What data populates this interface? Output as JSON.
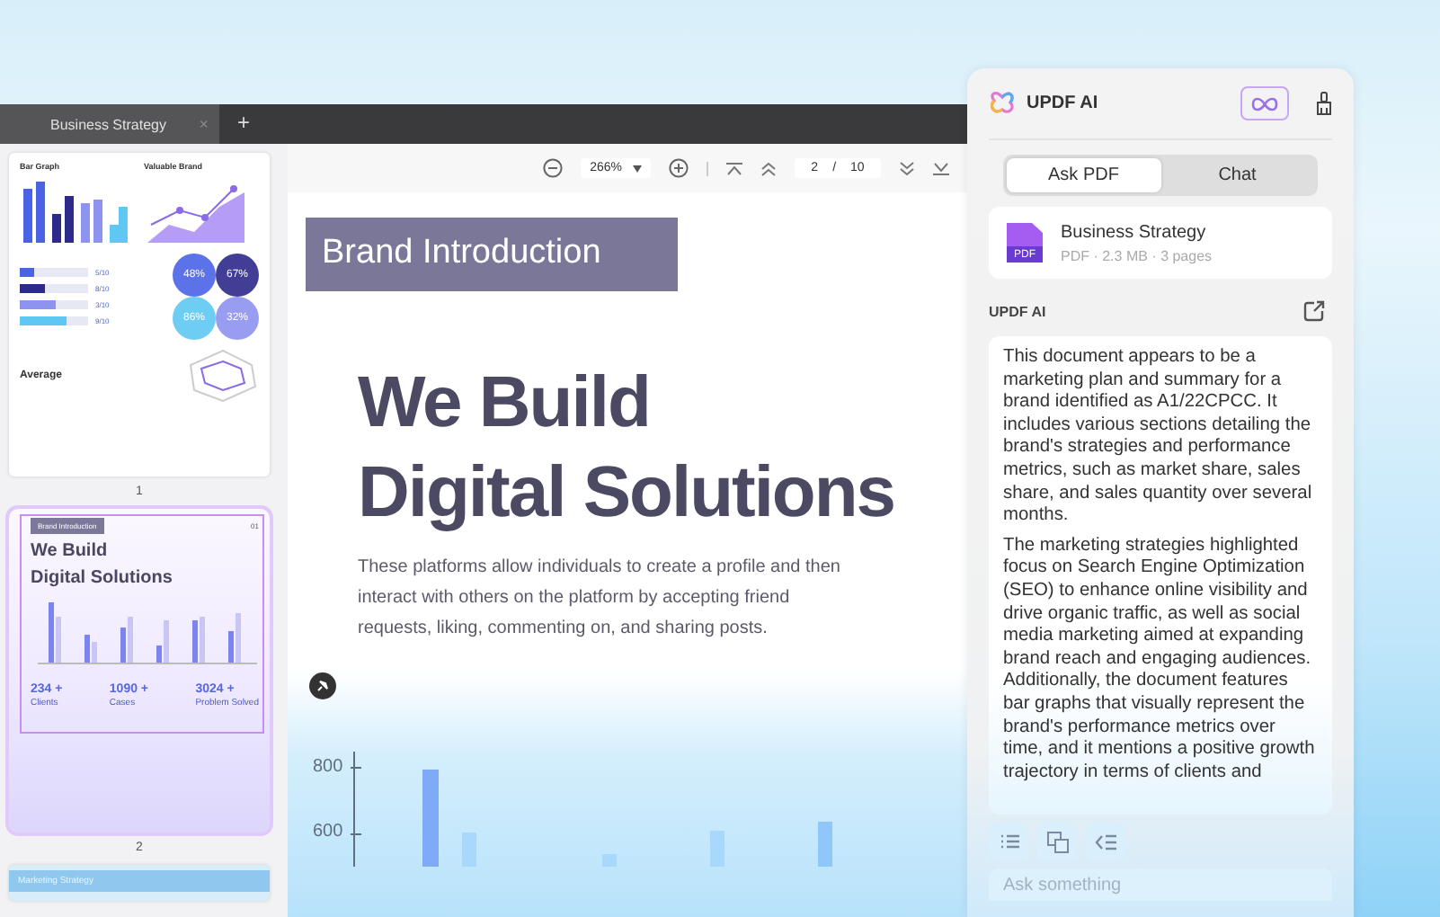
{
  "app_window": {
    "tabs": [
      {
        "label": "Business Strategy",
        "selected": true,
        "close": "×"
      }
    ],
    "new_tab": "+",
    "thumbnails": [
      {
        "kind": "infographic",
        "page_number": "1",
        "selected": false,
        "titles": [
          "Bar Graph",
          "Valuable Brand",
          "Average"
        ],
        "ratios": [
          "5/10",
          "8/10",
          "3/10",
          "9/10"
        ],
        "stats": [
          "48%",
          "67%",
          "86%",
          "32%"
        ]
      },
      {
        "kind": "brand",
        "page_number": "2",
        "selected": true,
        "banner": "Brand Introduction",
        "number": "01",
        "headline": [
          "We Build",
          "Digital Solutions"
        ],
        "stats": [
          {
            "value": "234 +",
            "label": "Clients"
          },
          {
            "value": "1090 +",
            "label": "Cases"
          },
          {
            "value": "3024 +",
            "label": "Problem Solved"
          }
        ]
      },
      {
        "kind": "cover",
        "selected": false,
        "banner": "Marketing Strategy"
      }
    ],
    "toolbar": {
      "zoom": "266%",
      "page": "2",
      "page_separator": "/",
      "page_total": "10"
    },
    "document": {
      "banner": "Brand Introduction",
      "headline": [
        "We Build",
        "Digital Solutions"
      ],
      "paragraph": "These platforms allow individuals to create a profile and then interact with others on the platform by accepting friend requests, liking, commenting on, and sharing posts.",
      "chart_tick_labels": [
        "800",
        "600"
      ]
    }
  },
  "ai_panel": {
    "title": "UPDF AI",
    "tabs": [
      {
        "label": "Ask PDF",
        "selected": true
      },
      {
        "label": "Chat",
        "selected": false
      }
    ],
    "file": {
      "icon_label": "PDF",
      "name": "Business Strategy",
      "meta": "PDF · 2.3 MB · 3 pages"
    },
    "section_label": "UPDF AI",
    "response": [
      "This document appears to be a marketing plan and summary for a brand identified as A1/22CPCC. It includes various sections detailing the brand's strategies and performance metrics, such as market share, sales share, and sales quantity over several months.",
      "The marketing strategies highlighted focus on Search Engine Optimization (SEO) to enhance online visibility and drive organic traffic, as well as social media marketing aimed at expanding brand reach and engaging audiences. Additionally, the document features bar graphs that visually represent the brand's performance metrics over time, and it mentions a positive growth trajectory in terms of clients and"
    ],
    "input": {
      "placeholder": "Ask something"
    }
  }
}
